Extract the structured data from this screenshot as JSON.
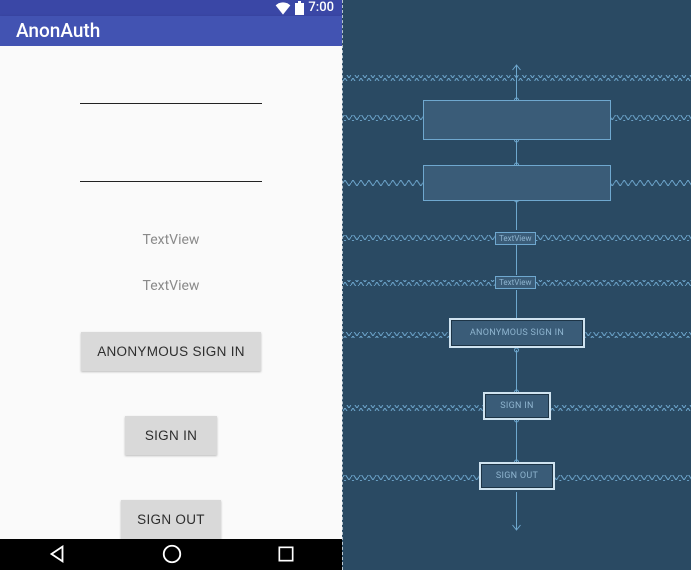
{
  "statusbar": {
    "time": "7:00"
  },
  "appbar": {
    "title": "AnonAuth"
  },
  "inputs": {
    "field1": "",
    "field2": ""
  },
  "textviews": {
    "tv1": "TextView",
    "tv2": "TextView"
  },
  "buttons": {
    "anon": "ANONYMOUS SIGN IN",
    "signin": "SIGN IN",
    "signout": "SIGN OUT"
  },
  "blueprint": {
    "tv1": "TextView",
    "tv2": "TextView",
    "anon": "ANONYMOUS SIGN IN",
    "signin": "SIGN IN",
    "signout": "SIGN OUT"
  }
}
